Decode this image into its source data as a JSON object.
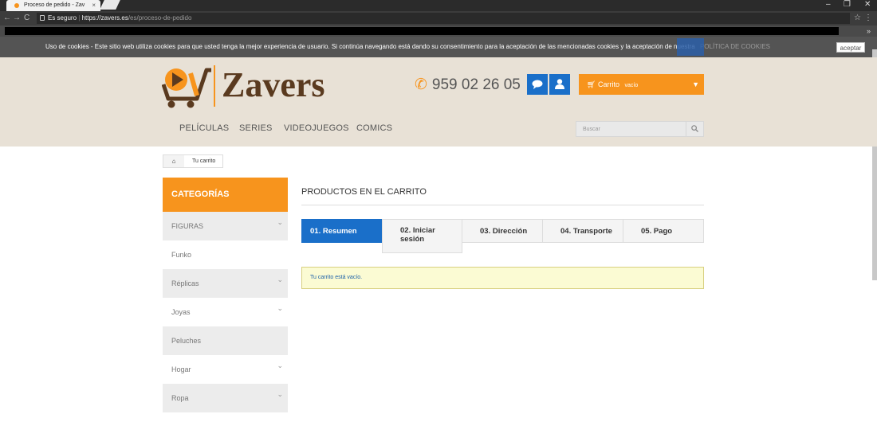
{
  "browser": {
    "tab_title": "Proceso de pedido - Zav",
    "tab_close": "×",
    "window_controls": [
      "–",
      "❐",
      "✕"
    ],
    "nav": [
      "←",
      "→",
      "C"
    ],
    "secure_label": "Es seguro",
    "url_host": "https://zavers.es",
    "url_path": "/es/proceso-de-pedido",
    "bookmark_more": "»"
  },
  "cookie_bar": {
    "text": "Uso de cookies - Este sitio web utiliza cookies para que usted tenga la mejor experiencia de usuario. Si continúa navegando está dando su consentimiento para la aceptación de las mencionadas cookies y la aceptación de nuestra",
    "link": "POLÍTICA DE COOKIES",
    "accept": "aceptar"
  },
  "header": {
    "logo_text": "Zavers",
    "phone": "959 02 26 05",
    "cart_label": "Carrito",
    "cart_status": "vacío"
  },
  "menu": {
    "items": [
      "PELÍCULAS",
      "SERIES",
      "VIDEOJUEGOS",
      "COMICS"
    ]
  },
  "search": {
    "placeholder": "Buscar"
  },
  "breadcrumb": {
    "current": "Tu carrito"
  },
  "sidebar": {
    "title": "CATEGORÍAS",
    "items": [
      {
        "label": "FIGURAS",
        "expandable": true
      },
      {
        "label": "Funko",
        "expandable": false
      },
      {
        "label": "Réplicas",
        "expandable": true
      },
      {
        "label": "Joyas",
        "expandable": true
      },
      {
        "label": "Peluches",
        "expandable": false
      },
      {
        "label": "Hogar",
        "expandable": true
      },
      {
        "label": "Ropa",
        "expandable": true
      }
    ]
  },
  "main": {
    "title": "PRODUCTOS EN EL CARRITO",
    "steps": [
      "01. Resumen",
      "02. Iniciar sesión",
      "03. Dirección",
      "04. Transporte",
      "05. Pago"
    ],
    "active_step": 1,
    "alert": "Tu carrito está vacío."
  },
  "colors": {
    "accent": "#f7941d",
    "primary": "#1a6fc9",
    "header_bg": "#e8e1d6",
    "logo_brown": "#5a3a1f"
  }
}
